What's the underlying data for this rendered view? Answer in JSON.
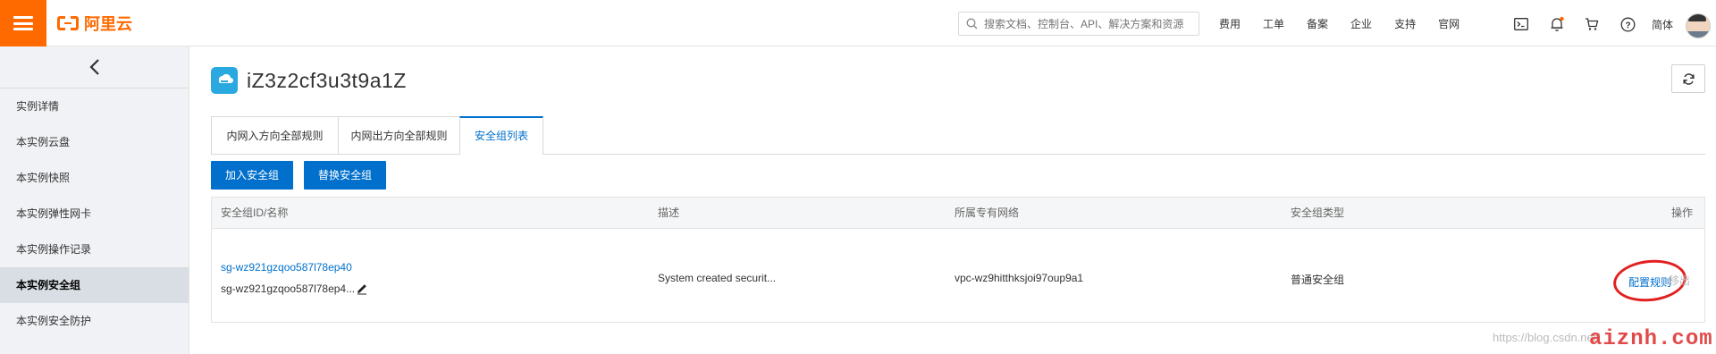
{
  "topbar": {
    "logo_text": "阿里云",
    "search_placeholder": "搜索文档、控制台、API、解决方案和资源",
    "nav": [
      "费用",
      "工单",
      "备案",
      "企业",
      "支持",
      "官网"
    ],
    "lang": "简体",
    "brand_color": "#ff6a00"
  },
  "sidebar": {
    "items": [
      {
        "label": "实例详情"
      },
      {
        "label": "本实例云盘"
      },
      {
        "label": "本实例快照"
      },
      {
        "label": "本实例弹性网卡"
      },
      {
        "label": "本实例操作记录"
      },
      {
        "label": "本实例安全组"
      },
      {
        "label": "本实例安全防护"
      }
    ],
    "active_index": 5
  },
  "header": {
    "title": "iZ3z2cf3u3t9a1Z"
  },
  "tabs": [
    {
      "label": "内网入方向全部规则"
    },
    {
      "label": "内网出方向全部规则"
    },
    {
      "label": "安全组列表"
    }
  ],
  "active_tab": 2,
  "actions": {
    "add": "加入安全组",
    "replace": "替换安全组"
  },
  "table": {
    "columns": [
      "安全组ID/名称",
      "描述",
      "所属专有网络",
      "安全组类型",
      "操作"
    ],
    "rows": [
      {
        "id": "sg-wz921gzqoo587l78ep40",
        "name": "sg-wz921gzqoo587l78ep4...",
        "description": "System created securit...",
        "vpc": "vpc-wz9hitthksjoi97oup9a1",
        "type": "普通安全组",
        "op_config": "配置规则",
        "op_remove": "移出"
      }
    ]
  },
  "watermark": "https://blog.csdn.net/",
  "brand_watermark": "aiznh.com",
  "accent_color": "#0070cc",
  "highlight_color": "#e32020"
}
